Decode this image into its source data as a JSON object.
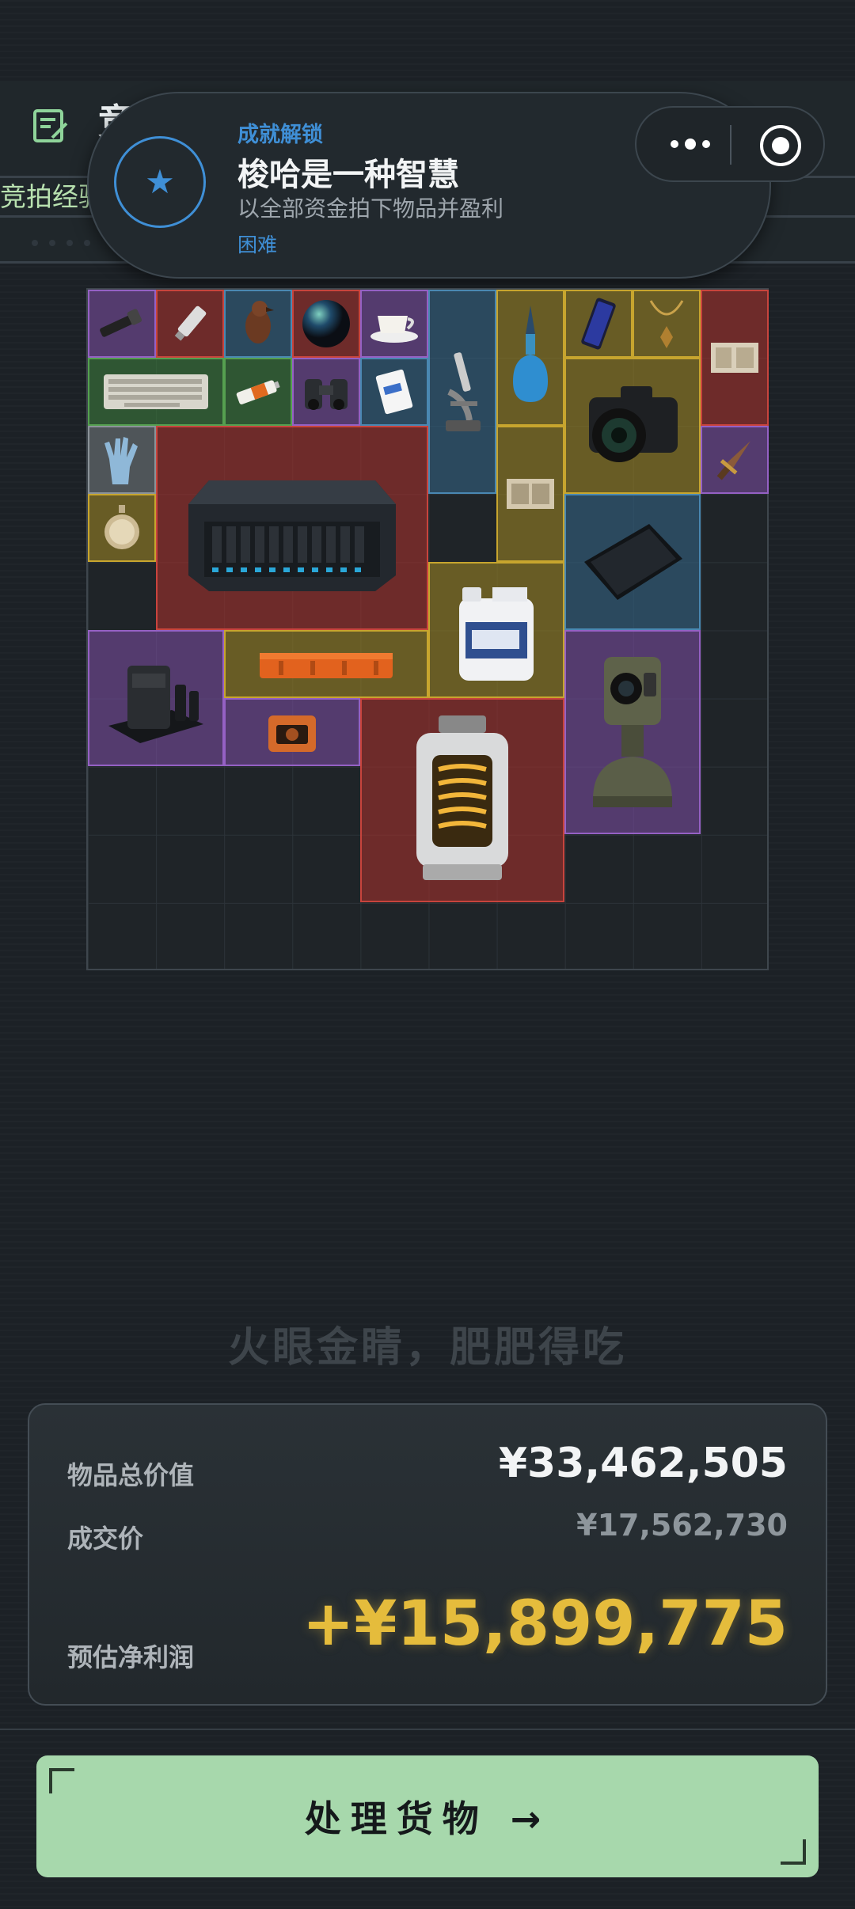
{
  "header": {
    "title": "竞",
    "subtitle": "竞拍经验"
  },
  "toast": {
    "kicker": "成就解锁",
    "title": "梭哈是一种智慧",
    "description": "以全部资金拍下物品并盈利",
    "difficulty": "困难",
    "badge_icon": "star-icon"
  },
  "capsule": {
    "more_icon": "more-dots-icon",
    "close_icon": "target-close-icon"
  },
  "grid": {
    "columns": 10,
    "rows": 10,
    "items": [
      {
        "name": "flashlight",
        "rarity": "purple"
      },
      {
        "name": "usb-drive",
        "rarity": "red"
      },
      {
        "name": "bird-figurine",
        "rarity": "blue"
      },
      {
        "name": "glass-orb",
        "rarity": "red"
      },
      {
        "name": "teacup",
        "rarity": "purple"
      },
      {
        "name": "microscope",
        "rarity": "blue"
      },
      {
        "name": "perfume-bottle",
        "rarity": "gold"
      },
      {
        "name": "smartphone",
        "rarity": "gold"
      },
      {
        "name": "pendant",
        "rarity": "gold"
      },
      {
        "name": "old-documents",
        "rarity": "red"
      },
      {
        "name": "keyboard",
        "rarity": "green"
      },
      {
        "name": "battery",
        "rarity": "green"
      },
      {
        "name": "binoculars",
        "rarity": "purple"
      },
      {
        "name": "card-deck",
        "rarity": "blue"
      },
      {
        "name": "dslr-camera",
        "rarity": "gold"
      },
      {
        "name": "gloves",
        "rarity": "gray"
      },
      {
        "name": "server-case",
        "rarity": "red"
      },
      {
        "name": "dagger",
        "rarity": "purple"
      },
      {
        "name": "pocket-watch",
        "rarity": "gold"
      },
      {
        "name": "ancient-map",
        "rarity": "gold"
      },
      {
        "name": "tablet",
        "rarity": "blue"
      },
      {
        "name": "chemical-jug",
        "rarity": "gold"
      },
      {
        "name": "coffee-machine",
        "rarity": "purple"
      },
      {
        "name": "orange-crate",
        "rarity": "gold"
      },
      {
        "name": "sensor-turret",
        "rarity": "purple"
      },
      {
        "name": "small-device",
        "rarity": "purple"
      },
      {
        "name": "reactor-core",
        "rarity": "red"
      }
    ]
  },
  "slogan": "火眼金睛，肥肥得吃",
  "summary": {
    "total_value_label": "物品总价值",
    "total_value": "¥33,462,505",
    "deal_price_label": "成交价",
    "deal_price": "¥17,562,730",
    "profit_label": "预估净利润",
    "profit": "+¥15,899,775"
  },
  "action": {
    "label": "处理货物 →"
  },
  "colors": {
    "purple": "#9561c4",
    "red": "#c8443d",
    "blue": "#4a88b2",
    "gold": "#c7a52e",
    "green": "#55a050",
    "gray": "#8b9399",
    "profit": "#e5bc3c",
    "button": "#a7d8ac",
    "accent": "#3f8fd6"
  }
}
